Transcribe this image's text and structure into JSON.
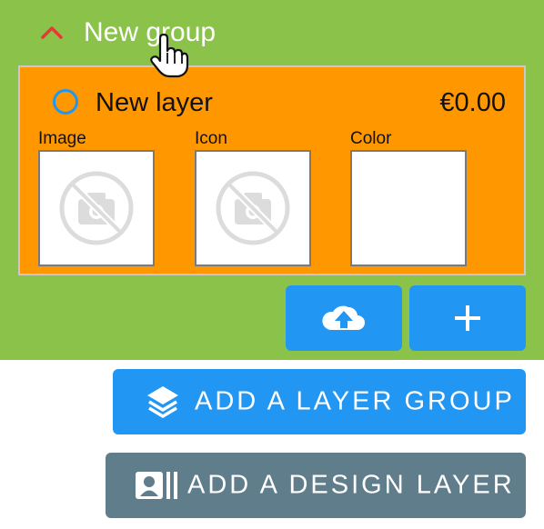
{
  "group": {
    "title": "New group",
    "expanded": true,
    "chevron_icon": "chevron-up-icon",
    "chevron_color": "#e53935",
    "background_color": "#8bc34a"
  },
  "layer": {
    "name": "New layer",
    "price": "€0.00",
    "selected": false,
    "background_color": "#ff9800",
    "fields": {
      "image_label": "Image",
      "icon_label": "Icon",
      "color_label": "Color"
    }
  },
  "actions": {
    "upload_icon": "cloud-upload-icon",
    "add_icon": "plus-icon",
    "add_layer_group": {
      "label": "ADD A LAYER GROUP",
      "icon": "layers-icon",
      "color": "#2196f3"
    },
    "add_design_layer": {
      "label": "ADD A DESIGN LAYER",
      "icon": "contact-card-icon",
      "color": "#607d8b"
    }
  },
  "cursor": "hand-pointer-icon"
}
